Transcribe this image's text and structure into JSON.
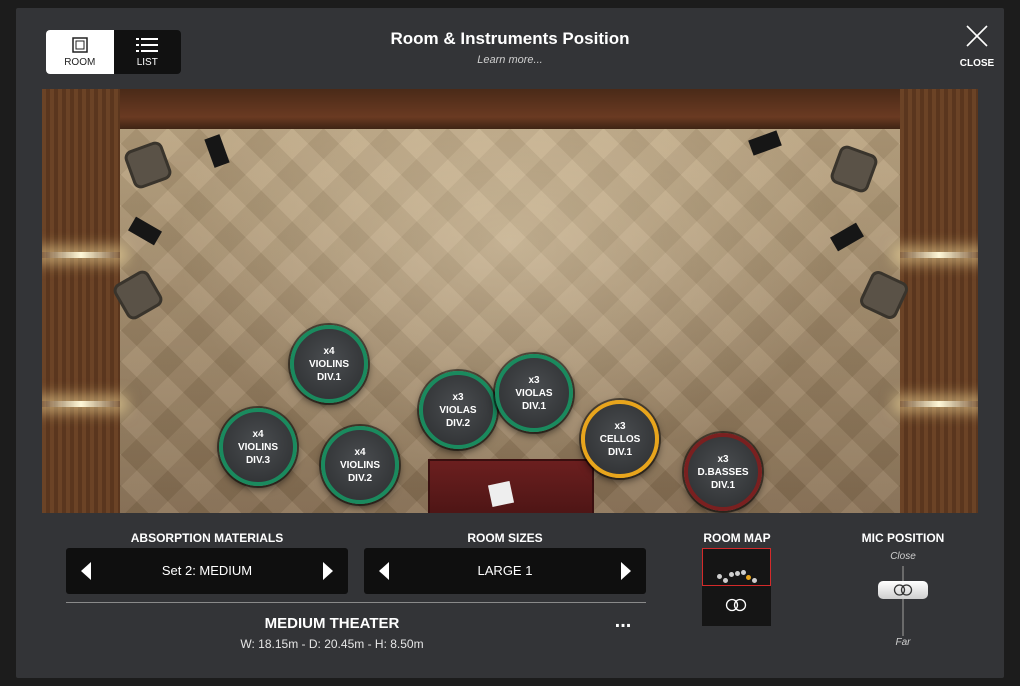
{
  "header": {
    "title": "Room & Instruments Position",
    "learn_more": "Learn more...",
    "close_label": "CLOSE"
  },
  "view_toggle": {
    "room_label": "ROOM",
    "list_label": "LIST",
    "selected": "ROOM"
  },
  "instruments": [
    {
      "count": "x4",
      "name": "VIOLINS",
      "division": "DIV.1",
      "ring_color": "#1a8a5e"
    },
    {
      "count": "x4",
      "name": "VIOLINS",
      "division": "DIV.3",
      "ring_color": "#1a8a5e"
    },
    {
      "count": "x4",
      "name": "VIOLINS",
      "division": "DIV.2",
      "ring_color": "#1a8a5e"
    },
    {
      "count": "x3",
      "name": "VIOLAS",
      "division": "DIV.2",
      "ring_color": "#1a8a5e"
    },
    {
      "count": "x3",
      "name": "VIOLAS",
      "division": "DIV.1",
      "ring_color": "#1a8a5e"
    },
    {
      "count": "x3",
      "name": "CELLOS",
      "division": "DIV.1",
      "ring_color": "#e8a51c"
    },
    {
      "count": "x3",
      "name": "D.BASSES",
      "division": "DIV.1",
      "ring_color": "#7a2020"
    }
  ],
  "absorption": {
    "label": "ABSORPTION MATERIALS",
    "value": "Set 2: MEDIUM"
  },
  "room_sizes": {
    "label": "ROOM SIZES",
    "value": "LARGE 1"
  },
  "room_info": {
    "name": "MEDIUM THEATER",
    "dimensions": "W: 18.15m - D: 20.45m - H: 8.50m",
    "more": "..."
  },
  "room_map": {
    "label": "ROOM MAP"
  },
  "mic_position": {
    "label": "MIC POSITION",
    "close_label": "Close",
    "far_label": "Far",
    "level": 0.25
  },
  "icons": {
    "room": "room-square-icon",
    "list": "list-icon",
    "close": "close-x-icon",
    "arrow_left": "arrow-left-icon",
    "arrow_right": "arrow-right-icon",
    "mic": "stereo-mic-icon"
  }
}
